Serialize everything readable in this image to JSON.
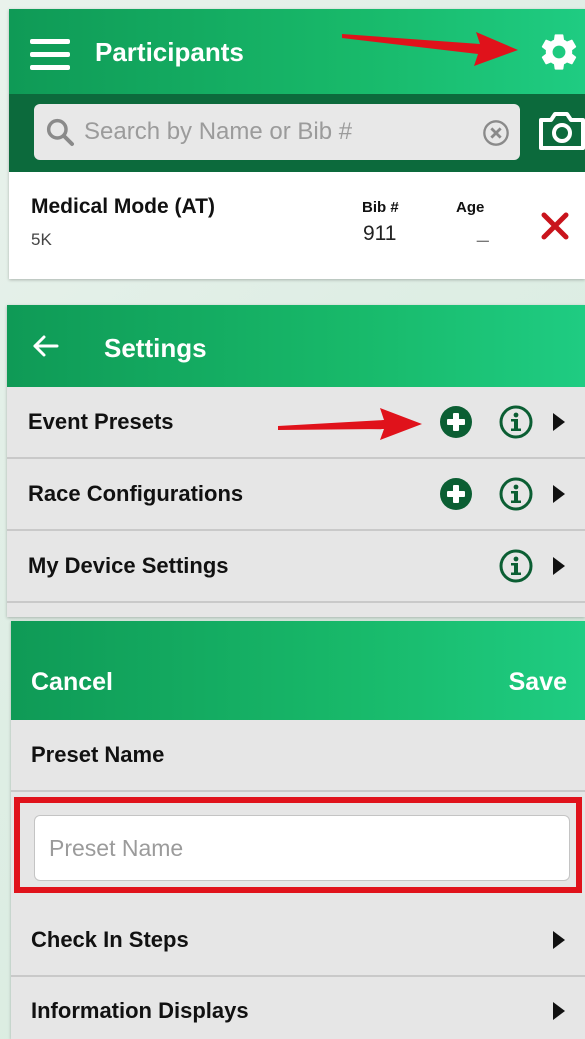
{
  "participants": {
    "title": "Participants",
    "search_placeholder": "Search by Name or Bib #",
    "row": {
      "name": "Medical Mode (AT)",
      "event": "5K",
      "bib_header": "Bib #",
      "bib_value": "911",
      "age_header": "Age",
      "age_value": "_"
    }
  },
  "settings": {
    "title": "Settings",
    "rows": [
      {
        "label": "Event Presets"
      },
      {
        "label": "Race Configurations"
      },
      {
        "label": "My Device Settings"
      }
    ]
  },
  "preset_form": {
    "cancel_label": "Cancel",
    "save_label": "Save",
    "name_header": "Preset Name",
    "name_placeholder": "Preset Name",
    "name_value": "",
    "rows": [
      {
        "label": "Check In Steps"
      },
      {
        "label": "Information Displays"
      }
    ]
  },
  "colors": {
    "header_green": "#18b96a",
    "dark_green": "#0c6a3c",
    "icon_green": "#0b5e33",
    "annotation_red": "#e0121b"
  },
  "icons": {
    "menu": "hamburger-icon",
    "settings": "gear-icon",
    "search": "search-icon",
    "clear": "clear-icon",
    "camera": "camera-icon",
    "delete": "close-icon",
    "back": "back-arrow-icon",
    "add": "plus-circle-icon",
    "info": "info-icon",
    "disclosure": "triangle-right-icon"
  }
}
